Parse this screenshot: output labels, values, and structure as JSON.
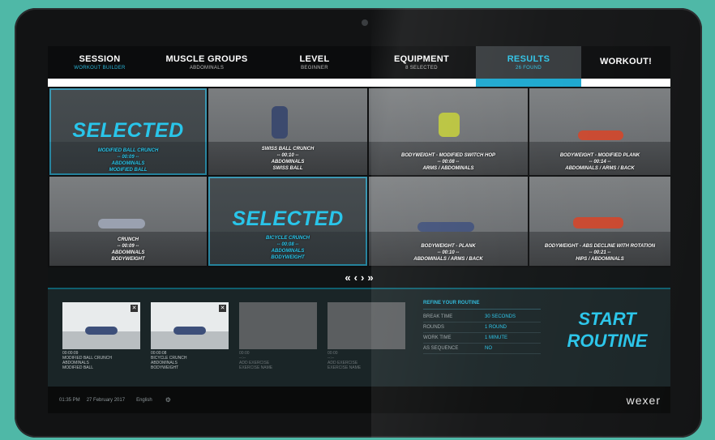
{
  "nav": [
    {
      "title": "SESSION",
      "sub": "WORKOUT BUILDER"
    },
    {
      "title": "MUSCLE GROUPS",
      "sub": "ABDOMINALS"
    },
    {
      "title": "LEVEL",
      "sub": "BEGINNER"
    },
    {
      "title": "EQUIPMENT",
      "sub": "8 SELECTED"
    },
    {
      "title": "RESULTS",
      "sub": "26 FOUND"
    },
    {
      "title": "WORKOUT!",
      "sub": ""
    }
  ],
  "selected_label": "SELECTED",
  "tiles": [
    {
      "l1": "MODIFIED BALL CRUNCH",
      "l2": "-- 00:09 --",
      "l3": "ABDOMINALS",
      "l4": "MODIFIED BALL"
    },
    {
      "l1": "SWISS BALL CRUNCH",
      "l2": "-- 00:10 --",
      "l3": "ABDOMINALS",
      "l4": "SWISS BALL"
    },
    {
      "l1": "BODYWEIGHT - MODIFIED SWITCH HOP",
      "l2": "-- 00:08 --",
      "l3": "ARMS / ABDOMINALS",
      "l4": ""
    },
    {
      "l1": "BODYWEIGHT - MODIFIED PLANK",
      "l2": "-- 00:14 --",
      "l3": "ABDOMINALS / ARMS / BACK",
      "l4": ""
    },
    {
      "l1": "CRUNCH",
      "l2": "-- 00:09 --",
      "l3": "ABDOMINALS",
      "l4": "BODYWEIGHT"
    },
    {
      "l1": "BICYCLE CRUNCH",
      "l2": "-- 00:08 --",
      "l3": "ABDOMINALS",
      "l4": "BODYWEIGHT"
    },
    {
      "l1": "BODYWEIGHT - PLANK",
      "l2": "-- 00:10 --",
      "l3": "ABDOMINALS / ARMS / BACK",
      "l4": ""
    },
    {
      "l1": "BODYWEIGHT - ABS DECLINE WITH ROTATION",
      "l2": "-- 00:21 --",
      "l3": "HIPS / ABDOMINALS",
      "l4": ""
    }
  ],
  "pager": {
    "first": "«",
    "prev": "‹",
    "next": "›",
    "last": "»"
  },
  "routine_slots": [
    {
      "l1": "00:00:09",
      "l2": "MODIFIED BALL CRUNCH",
      "l3": "ABDOMINALS",
      "l4": "MODIFIED BALL"
    },
    {
      "l1": "00:00:08",
      "l2": "BICYCLE CRUNCH",
      "l3": "ABDOMINALS",
      "l4": "BODYWEIGHT"
    },
    {
      "l1": "00:00",
      "l2": "--:--",
      "l3": "ADD EXERCISE",
      "l4": "EXERCISE NAME"
    },
    {
      "l1": "00:00",
      "l2": "--:--",
      "l3": "ADD EXERCISE",
      "l4": "EXERCISE NAME"
    }
  ],
  "refine": {
    "title": "REFINE YOUR ROUTINE",
    "rows": [
      {
        "k": "BREAK TIME",
        "v": "30 SECONDS"
      },
      {
        "k": "ROUNDS",
        "v": "1 ROUND"
      },
      {
        "k": "WORK TIME",
        "v": "1 MINUTE"
      },
      {
        "k": "AS SEQUENCE",
        "v": "NO"
      }
    ]
  },
  "start": {
    "l1": "START",
    "l2": "ROUTINE"
  },
  "footer": {
    "time": "01:35 PM",
    "date": "27 February 2017",
    "lang": "English",
    "brand": "wexer"
  },
  "colors": {
    "accent": "#29c5ea",
    "tab_highlight": "#1aa7cf",
    "background": "#4fb8a7"
  }
}
